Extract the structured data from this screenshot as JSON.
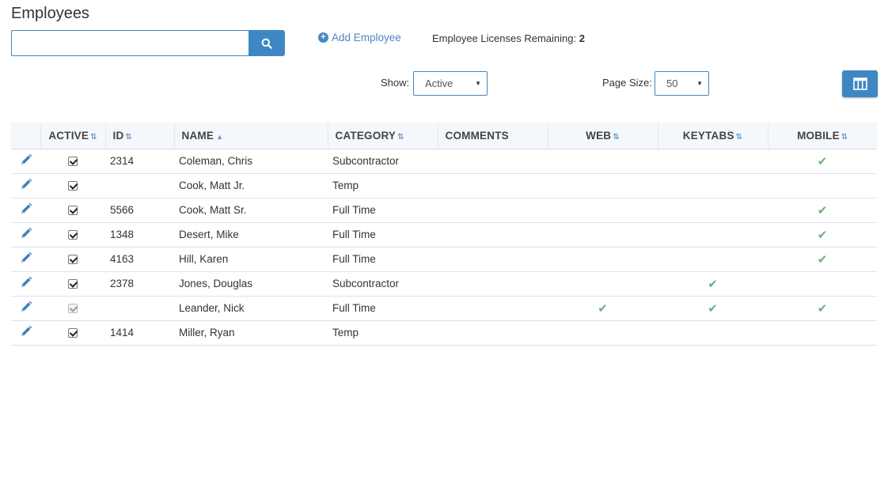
{
  "header": {
    "title": "Employees",
    "add_employee_label": "Add Employee",
    "licenses_label": "Employee Licenses Remaining:",
    "licenses_value": "2"
  },
  "search": {
    "placeholder": "",
    "value": ""
  },
  "filters": {
    "show_label": "Show:",
    "show_value": "Active",
    "page_size_label": "Page Size:",
    "page_size_value": "50"
  },
  "icons": {
    "search": "search-icon",
    "add": "plus-circle-icon",
    "columns": "columns-grid-icon",
    "edit": "pencil-icon",
    "check": "checkmark-icon"
  },
  "colors": {
    "accent": "#3f87c4",
    "link": "#4a87bf",
    "check_green": "#6ab07a"
  },
  "table": {
    "columns": [
      "ACTIVE",
      "ID",
      "NAME",
      "CATEGORY",
      "COMMENTS",
      "WEB",
      "KEYTABS",
      "MOBILE"
    ],
    "rows": [
      {
        "active": true,
        "active_disabled": false,
        "id": "2314",
        "name": "Coleman, Chris",
        "category": "Subcontractor",
        "comments": "",
        "web": false,
        "keytabs": false,
        "mobile": true
      },
      {
        "active": true,
        "active_disabled": false,
        "id": "",
        "name": "Cook, Matt Jr.",
        "category": "Temp",
        "comments": "",
        "web": false,
        "keytabs": false,
        "mobile": false
      },
      {
        "active": true,
        "active_disabled": false,
        "id": "5566",
        "name": "Cook, Matt Sr.",
        "category": "Full Time",
        "comments": "",
        "web": false,
        "keytabs": false,
        "mobile": true
      },
      {
        "active": true,
        "active_disabled": false,
        "id": "1348",
        "name": "Desert, Mike",
        "category": "Full Time",
        "comments": "",
        "web": false,
        "keytabs": false,
        "mobile": true
      },
      {
        "active": true,
        "active_disabled": false,
        "id": "4163",
        "name": "Hill, Karen",
        "category": "Full Time",
        "comments": "",
        "web": false,
        "keytabs": false,
        "mobile": true
      },
      {
        "active": true,
        "active_disabled": false,
        "id": "2378",
        "name": "Jones, Douglas",
        "category": "Subcontractor",
        "comments": "",
        "web": false,
        "keytabs": true,
        "mobile": false
      },
      {
        "active": true,
        "active_disabled": true,
        "id": "",
        "name": "Leander, Nick",
        "category": "Full Time",
        "comments": "",
        "web": true,
        "keytabs": true,
        "mobile": true
      },
      {
        "active": true,
        "active_disabled": false,
        "id": "1414",
        "name": "Miller, Ryan",
        "category": "Temp",
        "comments": "",
        "web": false,
        "keytabs": false,
        "mobile": false
      }
    ]
  }
}
